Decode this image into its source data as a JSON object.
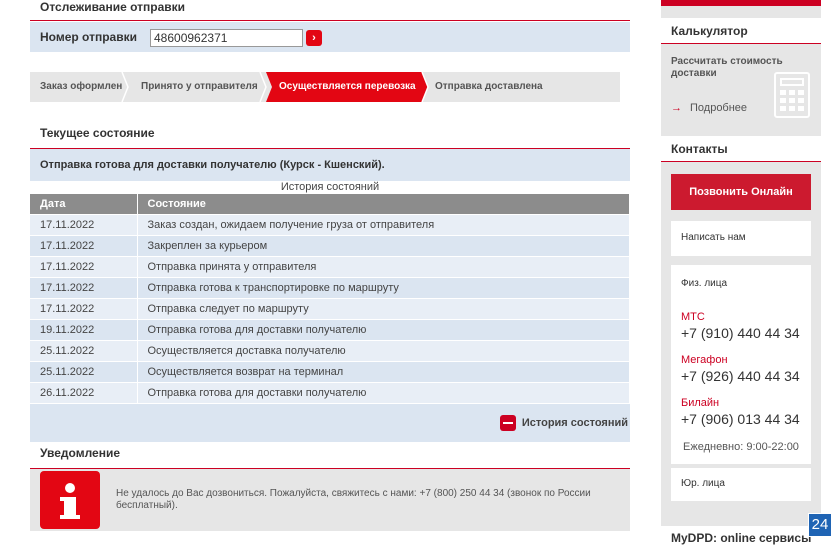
{
  "tracking": {
    "title": "Отслеживание отправки",
    "number_label": "Номер отправки",
    "number_value": "48600962371",
    "go_icon": "chevron-right-icon"
  },
  "steps": [
    {
      "label": "Заказ оформлен",
      "active": false
    },
    {
      "label": "Принято у отправителя",
      "active": false
    },
    {
      "label": "Осуществляется перевозка",
      "active": true
    },
    {
      "label": "Отправка доставлена",
      "active": false
    }
  ],
  "current": {
    "title": "Текущее состояние",
    "status": "Отправка готова для доставки получателю (Курск - Кшенский)."
  },
  "history": {
    "caption": "История состояний",
    "columns": [
      "Дата",
      "Состояние"
    ],
    "rows": [
      [
        "17.11.2022",
        "Заказ создан, ожидаем получение груза от отправителя"
      ],
      [
        "17.11.2022",
        "Закреплен за курьером"
      ],
      [
        "17.11.2022",
        "Отправка принята у отправителя"
      ],
      [
        "17.11.2022",
        "Отправка готова к транспортировке по маршруту"
      ],
      [
        "17.11.2022",
        "Отправка следует по маршруту"
      ],
      [
        "19.11.2022",
        "Отправка готова для доставки получателю"
      ],
      [
        "25.11.2022",
        "Осуществляется доставка получателю"
      ],
      [
        "25.11.2022",
        "Осуществляется возврат на терминал"
      ],
      [
        "26.11.2022",
        "Отправка готова для доставки получателю"
      ]
    ],
    "toggle_label": "История состояний"
  },
  "notice": {
    "title": "Уведомление",
    "icon": "info-icon",
    "message": "Не удалось до Вас дозвониться. Пожалуйста, свяжитесь с нами: +7 (800) 250 44 34 (звонок по России бесплатный)."
  },
  "sidebar": {
    "calculator": {
      "title": "Калькулятор",
      "text": "Рассчитать стоимость доставки",
      "more": "Подробнее"
    },
    "contacts": {
      "title": "Контакты",
      "call_button": "Позвонить Онлайн",
      "write_us": "Написать нам",
      "individuals": "Физ. лица",
      "operators": [
        {
          "name": "МТС",
          "phone": "+7 (910) 440 44 34"
        },
        {
          "name": "Мегафон",
          "phone": "+7 (926) 440 44 34"
        },
        {
          "name": "Билайн",
          "phone": "+7 (906) 013 44 34"
        }
      ],
      "hours": "Ежедневно: 9:00-22:00",
      "legal": "Юр. лица"
    },
    "mydpd": "MyDPD: online сервисы"
  },
  "chat_badge": "24",
  "colors": {
    "accent": "#e30613",
    "dark_red": "#cc0022",
    "light_blue": "#dbe5f1",
    "grey": "#e6e6e6",
    "table_header": "#8c8c8c"
  }
}
